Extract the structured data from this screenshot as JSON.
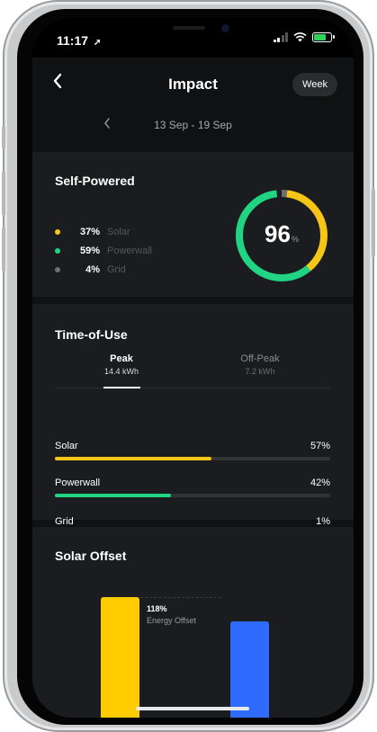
{
  "status_bar": {
    "time": "11:17",
    "location_arrow": "location-arrow-icon"
  },
  "header": {
    "title": "Impact",
    "period_button": "Week"
  },
  "date_range": {
    "label": "13 Sep - 19 Sep"
  },
  "self_powered": {
    "title": "Self-Powered",
    "value": "96",
    "unit": "%",
    "legend": [
      {
        "pct": "37%",
        "label": "Solar",
        "color": "#f5c518"
      },
      {
        "pct": "59%",
        "label": "Powerwall",
        "color": "#20d483"
      },
      {
        "pct": "4%",
        "label": "Grid",
        "color": "#6d6e72"
      }
    ],
    "donut_fractions": {
      "solar": 0.37,
      "powerwall": 0.59,
      "grid": 0.04
    }
  },
  "time_of_use": {
    "title": "Time-of-Use",
    "tabs": [
      {
        "name": "Peak",
        "energy": "14.4 kWh"
      },
      {
        "name": "Off-Peak",
        "energy": "7.2 kWh"
      }
    ],
    "bars": [
      {
        "label": "Solar",
        "pct": "57%",
        "fraction": 0.57,
        "color": "#f5c518"
      },
      {
        "label": "Powerwall",
        "pct": "42%",
        "fraction": 0.42,
        "color": "#20d483"
      },
      {
        "label": "Grid",
        "pct": "1%",
        "fraction": 0.01,
        "color": "#8b8c90"
      }
    ]
  },
  "solar_offset": {
    "title": "Solar Offset",
    "value": "118%",
    "caption": "Energy Offset",
    "colors": {
      "solar": "#ffcc00",
      "usage": "#2f6bff"
    }
  }
}
